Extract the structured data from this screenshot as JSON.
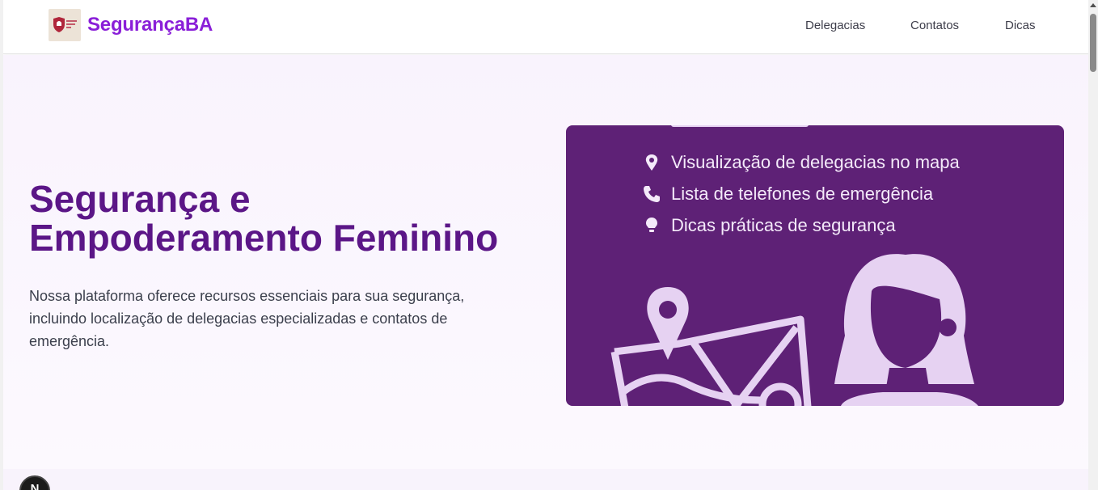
{
  "header": {
    "brand": "SegurançaBA",
    "nav": [
      {
        "label": "Delegacias"
      },
      {
        "label": "Contatos"
      },
      {
        "label": "Dicas"
      }
    ]
  },
  "hero": {
    "title": "Segurança e Empoderamento Feminino",
    "description": "Nossa plataforma oferece recursos essenciais para sua segurança, incluindo localização de delegacias especializadas e contatos de emergência.",
    "features": [
      {
        "icon": "map-pin-icon",
        "label": "Visualização de delegacias no mapa"
      },
      {
        "icon": "phone-icon",
        "label": "Lista de telefones de emergência"
      },
      {
        "icon": "lightbulb-icon",
        "label": "Dicas práticas de segurança"
      }
    ]
  },
  "badge": {
    "label": "N"
  },
  "colors": {
    "brand": "#8a1fd8",
    "title": "#5b1687",
    "card": "#5e2176",
    "card_art": "#e6d2f2"
  }
}
